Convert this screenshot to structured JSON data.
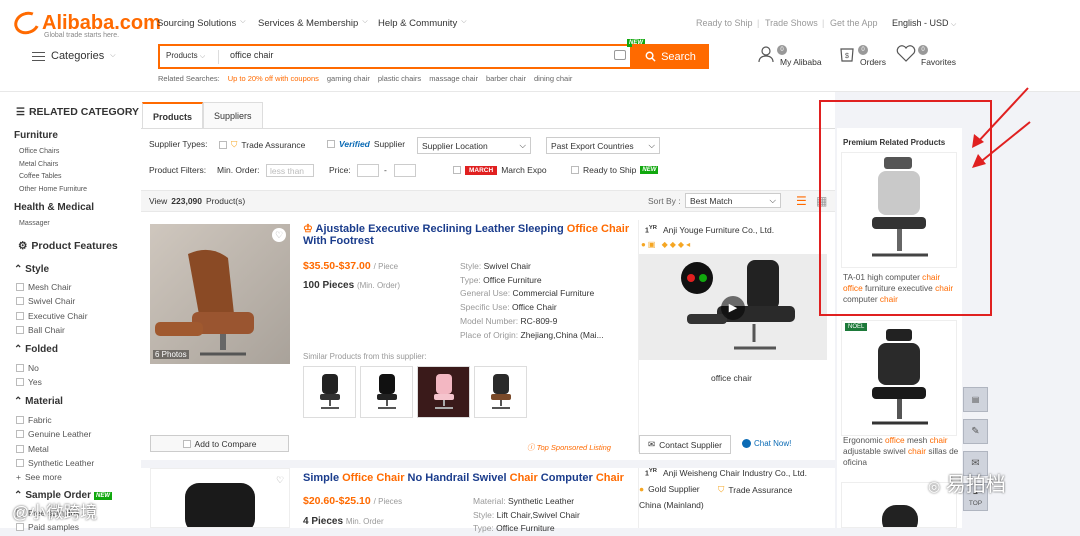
{
  "header": {
    "logo_text": "Alibaba.com",
    "logo_tagline": "Global trade starts here.",
    "nav": [
      "Sourcing Solutions",
      "Services & Membership",
      "Help & Community"
    ],
    "right_nav": [
      "Ready to Ship",
      "Trade Shows",
      "Get the App",
      "English - USD"
    ],
    "categories_label": "Categories",
    "search": {
      "scope": "Products",
      "value": "office chair",
      "new_badge": "NEW",
      "button": "Search"
    },
    "related_label": "Related Searches:",
    "related": [
      "Up to 20% off with coupons",
      "gaming chair",
      "plastic chairs",
      "massage chair",
      "barber chair",
      "dining chair"
    ],
    "user": [
      {
        "label": "My Alibaba",
        "count": "0"
      },
      {
        "label": "Orders",
        "count": "0"
      },
      {
        "label": "Favorites",
        "count": "0"
      }
    ]
  },
  "sidebar": {
    "related_title": "RELATED CATEGORY",
    "furniture": "Furniture",
    "furniture_items": [
      "Office Chairs",
      "Metal Chairs",
      "Coffee Tables",
      "Other Home Furniture"
    ],
    "health": "Health & Medical",
    "health_items": [
      "Massager"
    ],
    "features_title": "Product Features",
    "style": "Style",
    "style_items": [
      "Mesh Chair",
      "Swivel Chair",
      "Executive Chair",
      "Ball Chair"
    ],
    "folded": "Folded",
    "folded_items": [
      "No",
      "Yes"
    ],
    "material": "Material",
    "material_items": [
      "Fabric",
      "Genuine Leather",
      "Metal",
      "Synthetic Leather"
    ],
    "see_more": "See more",
    "sample": "Sample Order",
    "sample_new": "NEW",
    "sample_items": [
      "Free samples",
      "Paid samples"
    ]
  },
  "main": {
    "tabs": [
      "Products",
      "Suppliers"
    ],
    "supplier_types_label": "Supplier Types:",
    "trade_assurance": "Trade Assurance",
    "verified": "Verified",
    "verified_supplier": "Supplier",
    "supplier_location": "Supplier Location",
    "past_export": "Past Export Countries",
    "product_filters": "Product Filters:",
    "min_order": "Min. Order:",
    "less_than": "less than",
    "price": "Price:",
    "dash": "-",
    "march_badge": "MARCH",
    "march_expo": "March Expo",
    "ready_to_ship": "Ready to Ship",
    "ready_new": "NEW",
    "view_prefix": "View",
    "view_count": "223,090",
    "view_suffix": "Product(s)",
    "sort_by": "Sort By :",
    "sort_value": "Best Match",
    "products": [
      {
        "title_parts": [
          "Ajustable Executive Reclining Leather Sleeping ",
          "Office Chair",
          " With Footrest"
        ],
        "price": "$35.50-$37.00",
        "price_unit": "/ Piece",
        "moq": "100 Pieces",
        "moq_unit": "(Min. Order)",
        "photos": "6 Photos",
        "attrs": [
          [
            "Style:",
            "Swivel Chair"
          ],
          [
            "Type:",
            "Office Furniture"
          ],
          [
            "General Use:",
            "Commercial Furniture"
          ],
          [
            "Specific Use:",
            "Office Chair"
          ],
          [
            "Model Number:",
            "RC-809-9"
          ],
          [
            "Place of Origin:",
            "Zhejiang,China (Mai..."
          ]
        ],
        "similar": "Similar Products from this supplier:",
        "compare": "Add to Compare",
        "sponsored": "Top Sponsored Listing",
        "years": "1",
        "yr": "YR",
        "supplier": "Anji Youge Furniture Co., Ltd.",
        "video_caption": "office chair",
        "contact": "Contact Supplier",
        "chat": "Chat Now!"
      },
      {
        "title_parts": [
          "Simple ",
          "Office Chair",
          " No Handrail Swivel ",
          "Chair",
          " Computer ",
          "Chair"
        ],
        "price": "$20.60-$25.10",
        "price_unit": "/ Pieces",
        "moq": "4 Pieces",
        "moq_unit": "Min. Order",
        "attrs": [
          [
            "Material:",
            "Synthetic Leather"
          ],
          [
            "Style:",
            "Lift Chair,Swivel Chair"
          ],
          [
            "Type:",
            "Office Furniture"
          ]
        ],
        "years": "1",
        "yr": "YR",
        "supplier": "Anji Weisheng Chair Industry Co., Ltd.",
        "gold": "Gold Supplier",
        "trade": "Trade Assurance",
        "location": "China (Mainland)"
      }
    ]
  },
  "premium": {
    "title": "Premium Related Products",
    "items": [
      {
        "parts": [
          "TA-01 high computer ",
          "chair",
          " ",
          "office",
          " furniture executive ",
          "chair",
          " computer ",
          "chair"
        ]
      },
      {
        "badge": "NOEL",
        "parts": [
          "Ergonomic ",
          "office",
          " mesh ",
          "chair",
          " adjustable swivel ",
          "chair",
          " sillas de oficina"
        ]
      }
    ]
  },
  "float": {
    "top": "TOP"
  },
  "watermarks": [
    "@小微跨境",
    "易拍档"
  ],
  "colors": {
    "brand": "#ff6a00",
    "link": "#1a3c8c",
    "annotation": "#e02020"
  }
}
